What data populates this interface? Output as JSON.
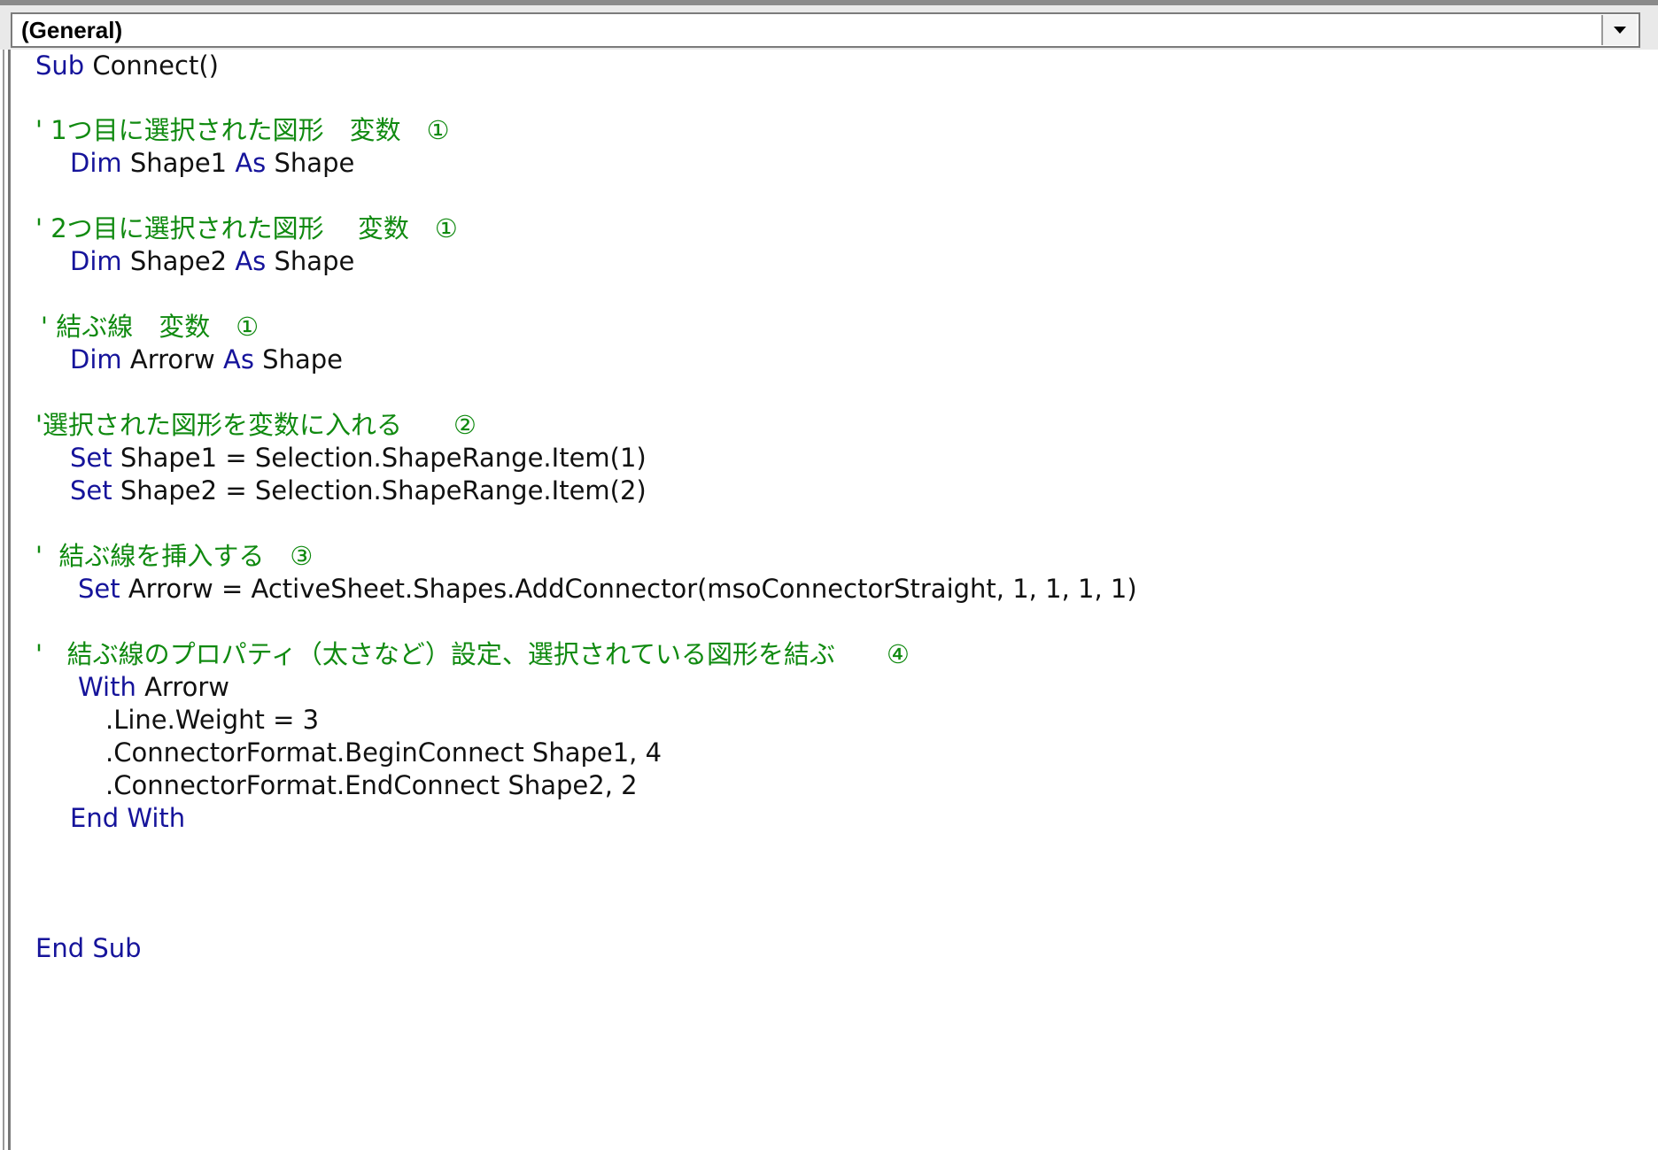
{
  "procedure_dropdown": {
    "value": "(General)"
  },
  "code_lines": [
    [
      {
        "k": "kw",
        "t": "Sub"
      },
      {
        "k": "tx",
        "t": " Connect()"
      }
    ],
    [],
    [
      {
        "k": "cm",
        "t": "' 1つ目に選択された図形　変数　①"
      }
    ],
    [
      {
        "k": "kw",
        "t": "Dim"
      },
      {
        "k": "tx",
        "t": " Shape1 "
      },
      {
        "k": "kw",
        "t": "As"
      },
      {
        "k": "tx",
        "t": " Shape"
      }
    ],
    [],
    [
      {
        "k": "cm",
        "t": "' 2つ目に選択された図形　 変数　①"
      }
    ],
    [
      {
        "k": "kw",
        "t": "Dim"
      },
      {
        "k": "tx",
        "t": " Shape2 "
      },
      {
        "k": "kw",
        "t": "As"
      },
      {
        "k": "tx",
        "t": " Shape"
      }
    ],
    [],
    [
      {
        "k": "cm",
        "t": "' 結ぶ線　変数　①"
      }
    ],
    [
      {
        "k": "kw",
        "t": "Dim"
      },
      {
        "k": "tx",
        "t": " Arrorw "
      },
      {
        "k": "kw",
        "t": "As"
      },
      {
        "k": "tx",
        "t": " Shape"
      }
    ],
    [],
    [
      {
        "k": "cm",
        "t": "'選択された図形を変数に入れる　　②"
      }
    ],
    [
      {
        "k": "kw",
        "t": "Set"
      },
      {
        "k": "tx",
        "t": " Shape1 = Selection.ShapeRange.Item(1)"
      }
    ],
    [
      {
        "k": "kw",
        "t": "Set"
      },
      {
        "k": "tx",
        "t": " Shape2 = Selection.ShapeRange.Item(2)"
      }
    ],
    [],
    [
      {
        "k": "cm",
        "t": "'  結ぶ線を挿入する　③"
      }
    ],
    [
      {
        "k": "kw",
        "t": "Set"
      },
      {
        "k": "tx",
        "t": " Arrorw = ActiveSheet.Shapes.AddConnector(msoConnectorStraight, 1, 1, 1, 1)"
      }
    ],
    [],
    [
      {
        "k": "cm",
        "t": "'   結ぶ線のプロパティ（太さなど）設定、選択されている図形を結ぶ　　④"
      }
    ],
    [
      {
        "k": "kw",
        "t": "With"
      },
      {
        "k": "tx",
        "t": " Arrorw"
      }
    ],
    [
      {
        "k": "tx",
        "t": ".Line.Weight = 3"
      }
    ],
    [
      {
        "k": "tx",
        "t": ".ConnectorFormat.BeginConnect Shape1, 4"
      }
    ],
    [
      {
        "k": "tx",
        "t": ".ConnectorFormat.EndConnect Shape2, 2"
      }
    ],
    [
      {
        "k": "kw",
        "t": "End With"
      }
    ],
    [],
    [],
    [],
    [
      {
        "k": "kw",
        "t": "End Sub"
      }
    ]
  ],
  "icons": {
    "dropdown_arrow": "chevron-down-icon"
  },
  "colors": {
    "keyword": "#16149b",
    "comment": "#108a10",
    "text": "#111111"
  }
}
